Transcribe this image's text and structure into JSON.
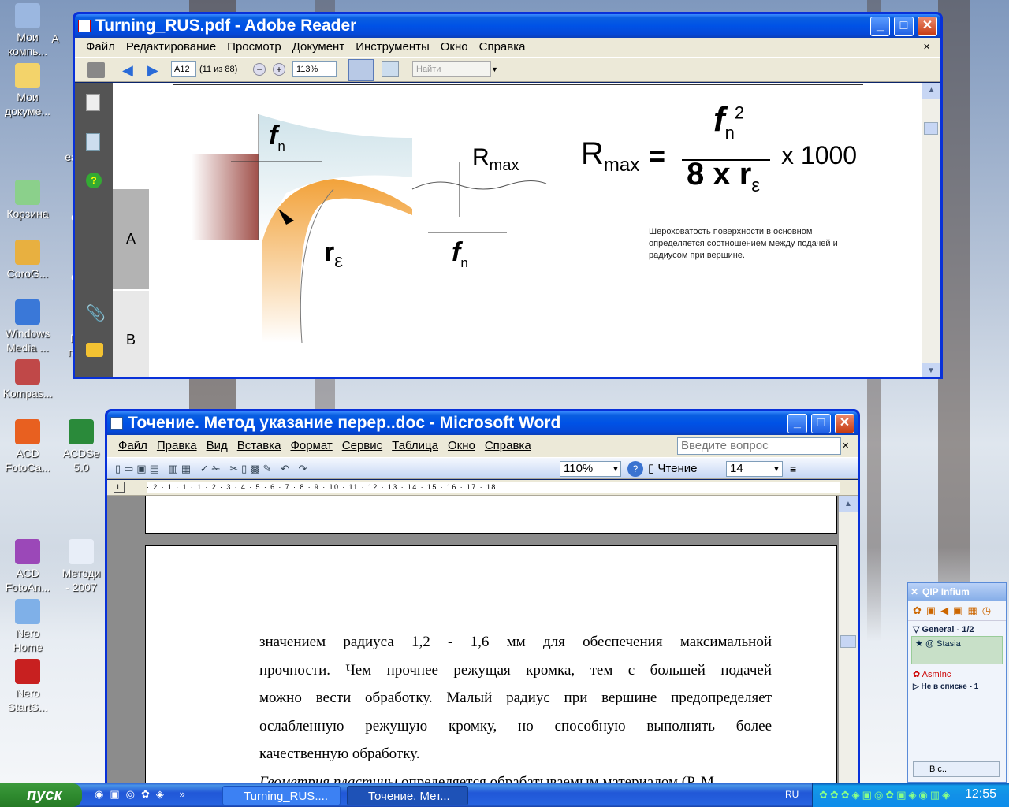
{
  "desktop": {
    "icons": [
      {
        "label": "Мои\nкомпь...",
        "icon": "computer-icon"
      },
      {
        "label": "Мои\nдокуме...",
        "icon": "folder-icon"
      },
      {
        "label": "Корзина",
        "icon": "recycle-bin-icon"
      },
      {
        "label": "CoroG...",
        "icon": "app-icon"
      },
      {
        "label": "Windows\nMedia ...",
        "icon": "media-player-icon"
      },
      {
        "label": "Kompas...",
        "icon": "archive-icon"
      },
      {
        "label": "ACD\nFotoCa...",
        "icon": "acd-icon"
      },
      {
        "label": "ACDSe\n5.0",
        "icon": "acd-eye-icon"
      },
      {
        "label": "ACD\nFotoAn...",
        "icon": "acd-fotoangelo-icon"
      },
      {
        "label": "Методи\n- 2007",
        "icon": "word-doc-icon"
      },
      {
        "label": "Nero\nHome",
        "icon": "nero-home-icon"
      },
      {
        "label": "Nero\nStartS...",
        "icon": "nero-start-icon"
      }
    ],
    "partial_labels": [
      "A",
      "ea",
      "q",
      "q",
      "П\nпр"
    ]
  },
  "reader": {
    "title": "Turning_RUS.pdf - Adobe Reader",
    "menu": [
      "Файл",
      "Редактирование",
      "Просмотр",
      "Документ",
      "Инструменты",
      "Окно",
      "Справка"
    ],
    "page_field": "A12",
    "page_info": "(11 из 88)",
    "zoom": "113%",
    "find_placeholder": "Найти",
    "tabs": [
      "A",
      "B"
    ],
    "doc": {
      "fn": "f",
      "fn_sub": "n",
      "rmax": "R",
      "rmax_sub": "max",
      "re": "r",
      "re_sub": "ε",
      "formula_lhs": "R",
      "formula_lhs_sub": "max",
      "formula_eq": "=",
      "formula_num": "f",
      "formula_num_sub": "n",
      "formula_num_sup": "2",
      "formula_den": "8 x r",
      "formula_den_sub": "ε",
      "formula_mult": "x 1000",
      "caption": "Шероховатость поверхности в основном определяется соотношением между подачей и радиусом при вершине."
    }
  },
  "word": {
    "title": "Точение. Метод указание перер..doc - Microsoft Word",
    "menu": [
      "Файл",
      "Правка",
      "Вид",
      "Вставка",
      "Формат",
      "Сервис",
      "Таблица",
      "Окно",
      "Справка"
    ],
    "ask_placeholder": "Введите вопрос",
    "zoom": "110%",
    "reading": "Чтение",
    "font_size": "14",
    "ruler": "· 2 · 1 · 1 · 1 · 2 · 3 · 4 · 5 · 6 · 7 · 8 · 9 · 10 · 11 · 12 · 13 · 14 · 15 · 16 · 17 · 18",
    "paragraph": [
      "значением радиуса 1,2 - 1,6 мм для обеспечения максимальной",
      "прочности. Чем прочнее режущая кромка, тем с большей подачей",
      "можно вести обработку. Малый радиус при вершине предопределяет",
      "ослабленную режущую кромку, но способную выполнять более",
      "качественную обработку."
    ],
    "next_italic": "Геометрия пластины",
    "next_rest": " определяется обрабатываемым материалом (P, M"
  },
  "qip": {
    "title": "QIP Infium",
    "group": "General - 1/2",
    "contacts": [
      "Stasia",
      "AsmInc"
    ],
    "not_in_list": "Не в списке - 1",
    "status_btn": "В с.."
  },
  "taskbar": {
    "start": "пуск",
    "tasks": [
      "Turning_RUS....",
      "Точение. Мет..."
    ],
    "lang": "RU",
    "clock": "12:55"
  }
}
